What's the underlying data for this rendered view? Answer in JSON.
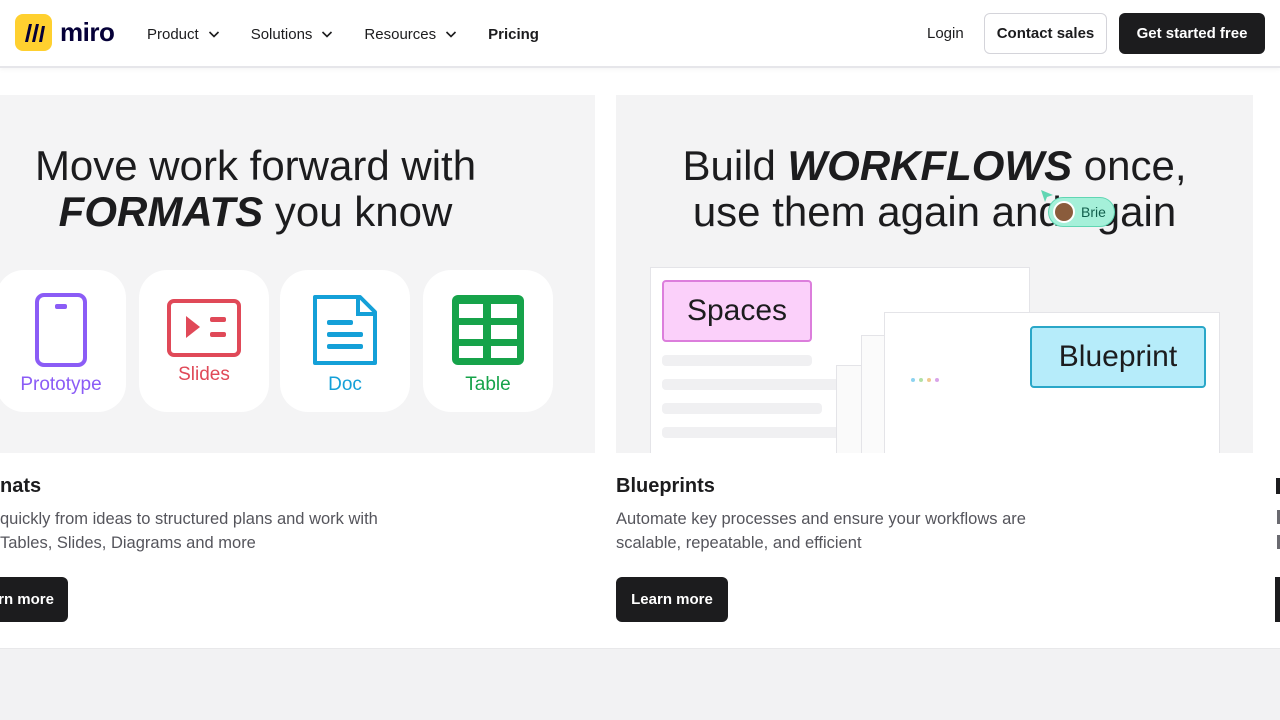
{
  "header": {
    "logo_text": "miro",
    "nav": [
      {
        "label": "Product",
        "has_dropdown": true
      },
      {
        "label": "Solutions",
        "has_dropdown": true
      },
      {
        "label": "Resources",
        "has_dropdown": true
      },
      {
        "label": "Pricing",
        "has_dropdown": false
      }
    ],
    "login_label": "Login",
    "contact_label": "Contact sales",
    "start_label": "Get started free"
  },
  "cards": [
    {
      "image_title_line1": "Move work forward with",
      "image_title_bold": "FORMATS",
      "image_title_line2_rest": " you know",
      "formats": [
        {
          "label": "Prototype",
          "color": "#8b5cf6"
        },
        {
          "label": "Slides",
          "color": "#e04958"
        },
        {
          "label": "Doc",
          "color": "#14a0d8"
        },
        {
          "label": "Table",
          "color": "#16a34a"
        }
      ],
      "title": "nats",
      "desc_line1": " quickly from ideas to structured plans and work with",
      "desc_line2": " Tables, Slides, Diagrams and more",
      "button_label": "rn more"
    },
    {
      "image_title_line1_pre": "Build ",
      "image_title_bold": "WORKFLOWS",
      "image_title_line1_post": " once,",
      "image_title_line2": "use them again and again",
      "tag_spaces": "Spaces",
      "tag_blueprint": "Blueprint",
      "cursor_user": "Brie",
      "title": "Blueprints",
      "desc_line1": "Automate key processes and ensure your workflows are",
      "desc_line2": "scalable, repeatable, and efficient",
      "button_label": "Learn more"
    }
  ],
  "colors": {
    "logo_yellow": "#ffd02f",
    "dark": "#1c1c1e",
    "spaces_bg": "#fbd0fa",
    "blueprint_bg": "#b6ecfa"
  }
}
